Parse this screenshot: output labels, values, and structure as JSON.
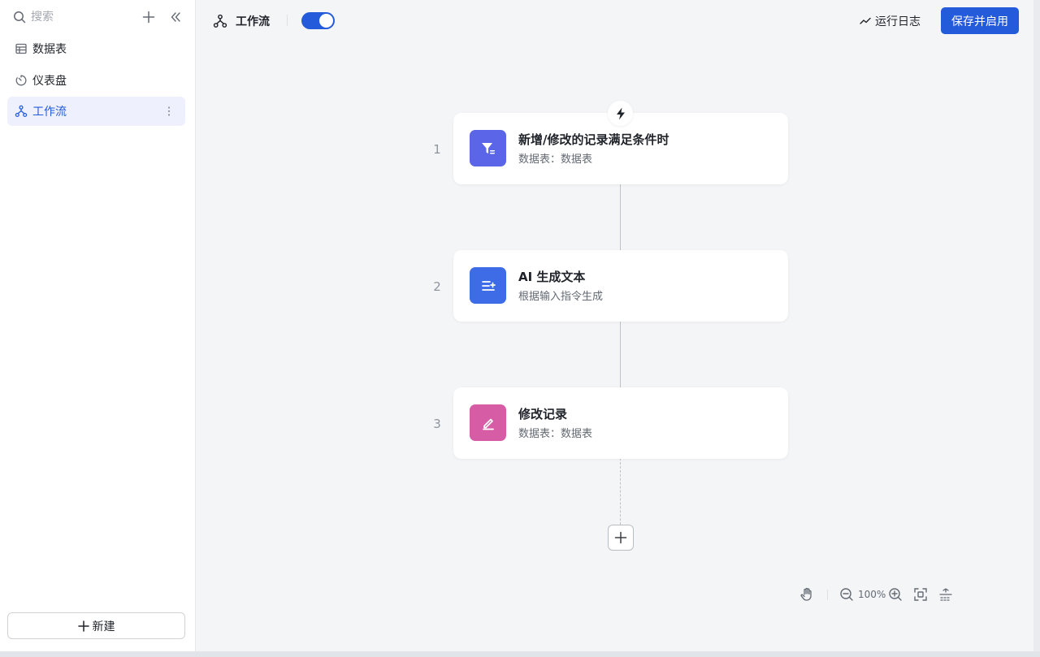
{
  "sidebar": {
    "search": {
      "placeholder": "搜索",
      "icon": "search-icon"
    },
    "items": [
      {
        "label": "数据表",
        "icon": "table-icon",
        "active": false
      },
      {
        "label": "仪表盘",
        "icon": "dashboard-icon",
        "active": false
      },
      {
        "label": "工作流",
        "icon": "workflow-icon",
        "active": true
      }
    ],
    "new_button": {
      "label": "新建",
      "icon": "plus-icon"
    }
  },
  "header": {
    "title": "工作流",
    "icon": "workflow-icon",
    "enabled": true,
    "run_log_label": "运行日志",
    "save_label": "保存并启用"
  },
  "flow": {
    "trigger_icon": "lightning-icon",
    "nodes": [
      {
        "step": "1",
        "title": "新增/修改的记录满足条件时",
        "subtitle": "数据表：数据表",
        "icon": "filter-icon",
        "color": "#5b65e8"
      },
      {
        "step": "2",
        "title": "AI 生成文本",
        "subtitle": "根据输入指令生成",
        "icon": "ai-text-icon",
        "color": "#3d6ce6"
      },
      {
        "step": "3",
        "title": "修改记录",
        "subtitle": "数据表：数据表",
        "icon": "edit-icon",
        "color": "#d65ca6"
      }
    ],
    "add_icon": "plus-icon"
  },
  "zoom": {
    "level": "100%"
  },
  "colors": {
    "accent": "#245bdb",
    "canvas": "#f4f5f7",
    "active_bg": "#eef1fd"
  }
}
